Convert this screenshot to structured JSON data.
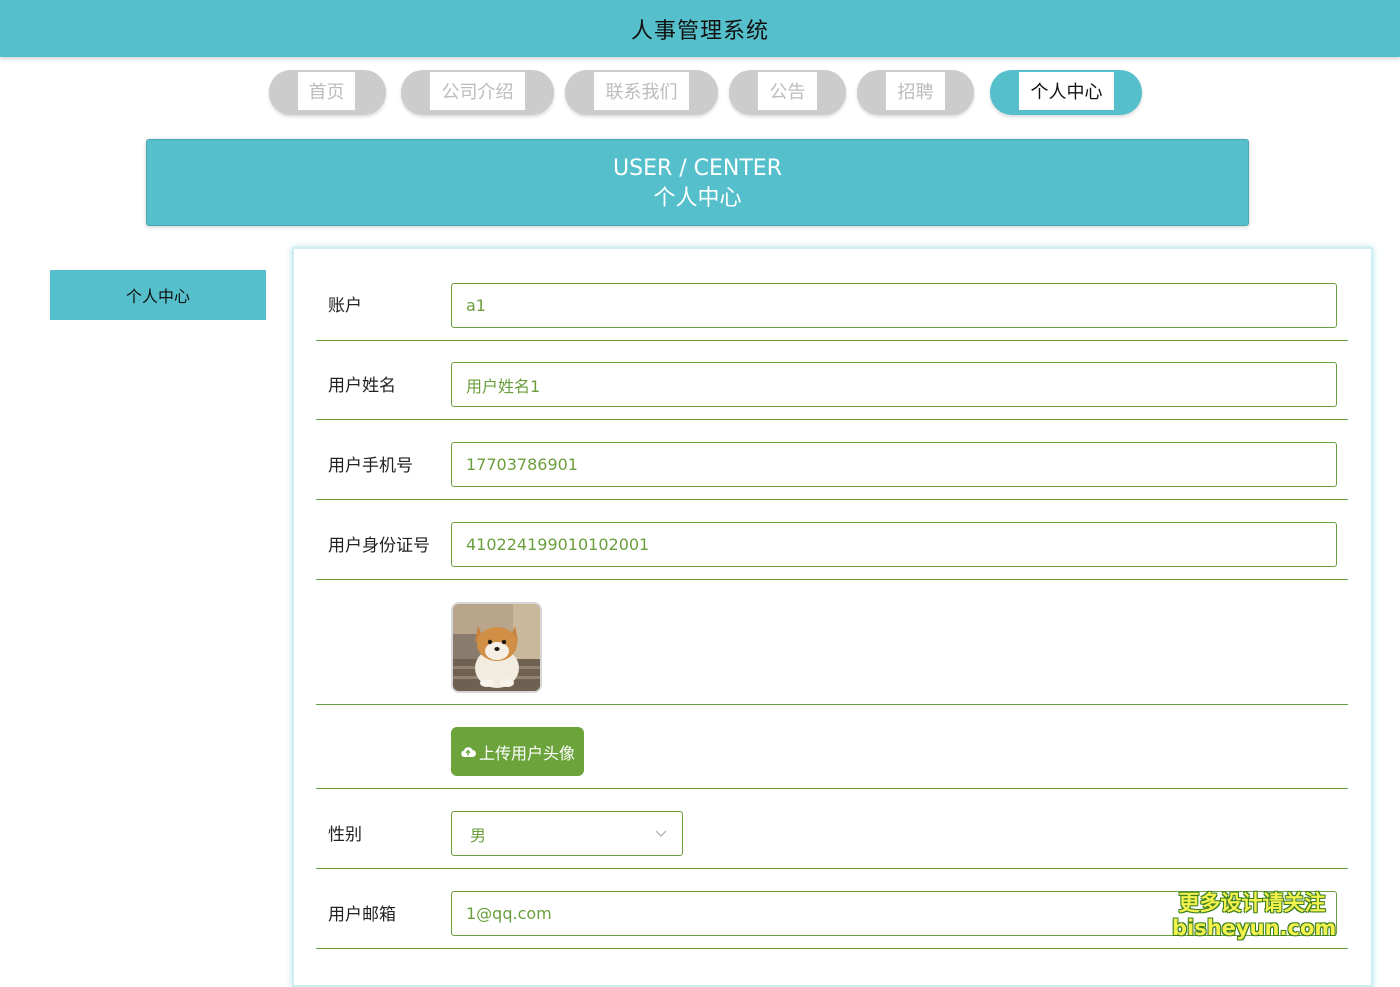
{
  "app": {
    "title": "人事管理系统"
  },
  "nav": [
    {
      "label": "首页",
      "active": false
    },
    {
      "label": "公司介绍",
      "active": false
    },
    {
      "label": "联系我们",
      "active": false
    },
    {
      "label": "公告",
      "active": false
    },
    {
      "label": "招聘",
      "active": false
    },
    {
      "label": "个人中心",
      "active": true
    }
  ],
  "banner": {
    "en": "USER / CENTER",
    "cn": "个人中心"
  },
  "sidebar": {
    "items": [
      {
        "label": "个人中心",
        "active": true
      }
    ]
  },
  "form": {
    "account": {
      "label": "账户",
      "value": "a1"
    },
    "name": {
      "label": "用户姓名",
      "value": "用户姓名1"
    },
    "phone": {
      "label": "用户手机号",
      "value": "17703786901"
    },
    "idcard": {
      "label": "用户身份证号",
      "value": "410224199010102001"
    },
    "avatar": {
      "icon": "shiba-inu-photo"
    },
    "upload": {
      "label": "上传用户头像",
      "icon": "cloud-upload-icon"
    },
    "gender": {
      "label": "性别",
      "value": "男"
    },
    "email": {
      "label": "用户邮箱",
      "value": "1@qq.com"
    }
  },
  "watermark": {
    "line1": "更多设计请关注",
    "line2": "bisheyun.com"
  },
  "colors": {
    "primary": "#55c0cc",
    "accent": "#6b9e3c",
    "button": "#6ca43b",
    "nav_inactive": "#cccccc"
  }
}
